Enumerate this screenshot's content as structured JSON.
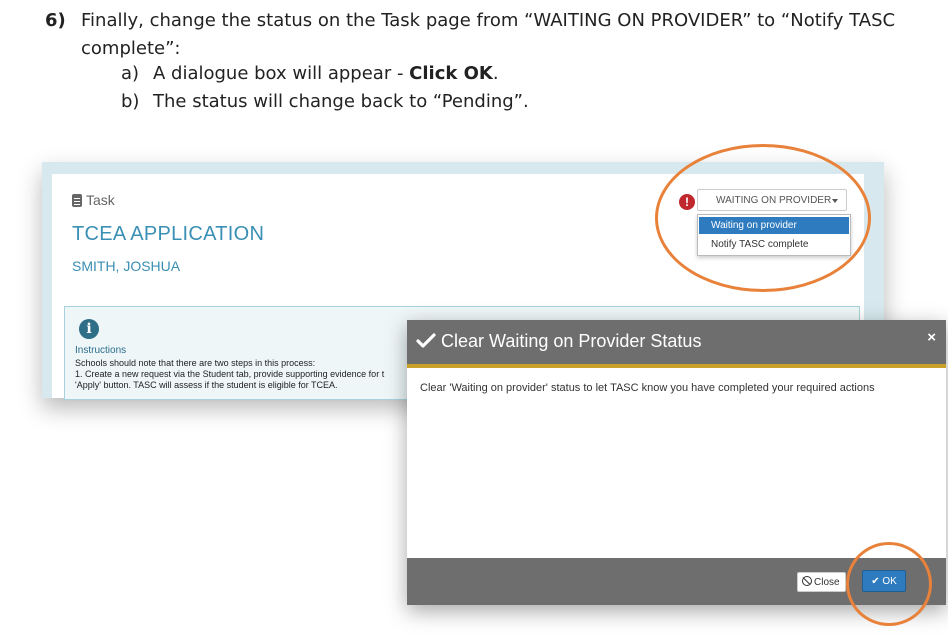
{
  "doc": {
    "step_number": "6)",
    "step_text_1": "Finally, change the status on the Task page from “WAITING ON PROVIDER” to “Notify TASC",
    "step_text_2": "complete”:",
    "sub_a_label": "a)",
    "sub_a_text": "A dialogue box will appear - ",
    "sub_a_bold": "Click OK",
    "sub_a_end": ".",
    "sub_b_label": "b)",
    "sub_b_text": "The status will change back to “Pending”."
  },
  "task": {
    "header": "Task",
    "title": "TCEA APPLICATION",
    "student_name": "SMITH, JOSHUA",
    "alert_glyph": "!",
    "status_value": "WAITING ON PROVIDER",
    "dropdown_options": [
      "Waiting on provider",
      "Notify TASC complete"
    ]
  },
  "instructions": {
    "icon_glyph": "i",
    "heading": "Instructions",
    "line1": "Schools should note that there are two steps in this process:",
    "line2": "1. Create a new request via the Student tab, provide supporting evidence for t",
    "line3": "'Apply' button. TASC will assess if the student is eligible for TCEA."
  },
  "modal": {
    "title": "Clear Waiting on Provider Status",
    "close_glyph": "×",
    "body": "Clear 'Waiting on provider' status to let TASC know you have completed your required actions",
    "close_label": "Close",
    "ok_label": "OK",
    "ok_glyph": "✔"
  },
  "colors": {
    "accent_blue": "#3a8fb4",
    "highlight_orange": "#e8823a",
    "modal_header": "#6e6e6e",
    "gold_rule": "#c9a12a",
    "ok_button": "#2f7bbf",
    "alert_red": "#c0282d"
  },
  "icons": [
    "clipboard-icon",
    "alert-icon",
    "caret-down-icon",
    "info-icon",
    "check-icon",
    "close-icon",
    "ban-icon"
  ]
}
